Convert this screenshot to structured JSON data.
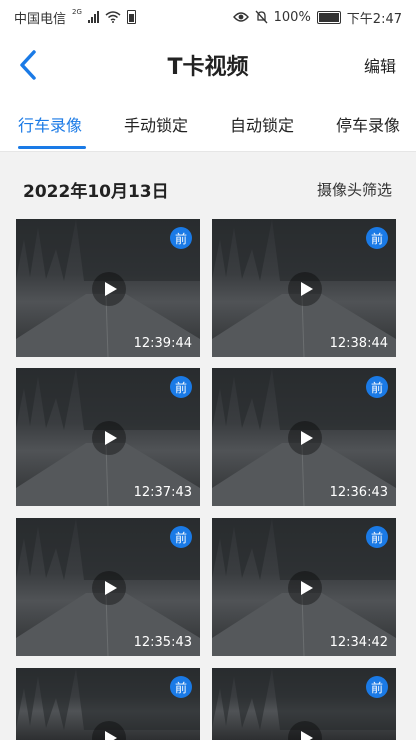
{
  "status_bar": {
    "carrier": "中国电信",
    "network": "2G",
    "battery_percent": "100%",
    "time": "下午2:47"
  },
  "header": {
    "title": "T卡视频",
    "edit_label": "编辑"
  },
  "tabs": [
    {
      "label": "行车录像",
      "active": true
    },
    {
      "label": "手动锁定",
      "active": false
    },
    {
      "label": "自动锁定",
      "active": false
    },
    {
      "label": "停车录像",
      "active": false
    }
  ],
  "date_section": {
    "date": "2022年10月13日",
    "filter_label": "摄像头筛选"
  },
  "videos": [
    {
      "badge": "前",
      "time": "12:39:44"
    },
    {
      "badge": "前",
      "time": "12:38:44"
    },
    {
      "badge": "前",
      "time": "12:37:43"
    },
    {
      "badge": "前",
      "time": "12:36:43"
    },
    {
      "badge": "前",
      "time": "12:35:43"
    },
    {
      "badge": "前",
      "time": "12:34:42"
    },
    {
      "badge": "前",
      "time": ""
    },
    {
      "badge": "前",
      "time": ""
    }
  ],
  "colors": {
    "accent": "#1a7ae6",
    "background": "#f2f2f2"
  }
}
